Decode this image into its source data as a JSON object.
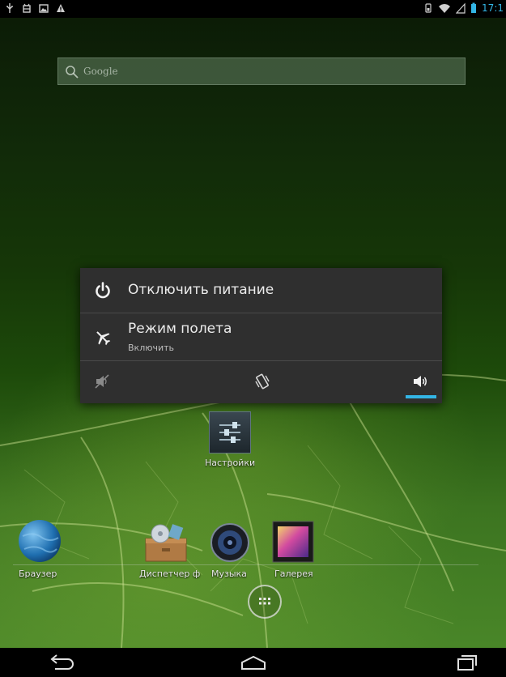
{
  "status_bar": {
    "time": "17:1",
    "left_icons": [
      "usb-icon",
      "android-debug-icon",
      "image-icon",
      "warning-icon"
    ],
    "right_icons": [
      "battery-small-icon",
      "wifi-icon",
      "signal-icon",
      "battery-icon"
    ]
  },
  "search": {
    "placeholder": "Google"
  },
  "power_dialog": {
    "power_off_label": "Отключить питание",
    "airplane_label": "Режим полета",
    "airplane_sub": "Включить",
    "sound_modes": [
      "silent-icon",
      "vibrate-icon",
      "sound-on-icon"
    ],
    "selected_sound_mode": "sound-on-icon"
  },
  "home": {
    "settings_label": "Настройки",
    "dock_apps": [
      {
        "label": "Браузер",
        "icon": "globe-icon"
      },
      {
        "label": "Диспетчер ф",
        "icon": "file-manager-icon"
      },
      {
        "label": "Музыка",
        "icon": "music-speaker-icon"
      },
      {
        "label": "Галерея",
        "icon": "gallery-icon"
      }
    ]
  },
  "colors": {
    "accent": "#33b5e5",
    "dialog_bg": "#2f2f2f"
  },
  "nav": {
    "buttons": [
      "back-icon",
      "home-icon",
      "recent-apps-icon"
    ]
  }
}
